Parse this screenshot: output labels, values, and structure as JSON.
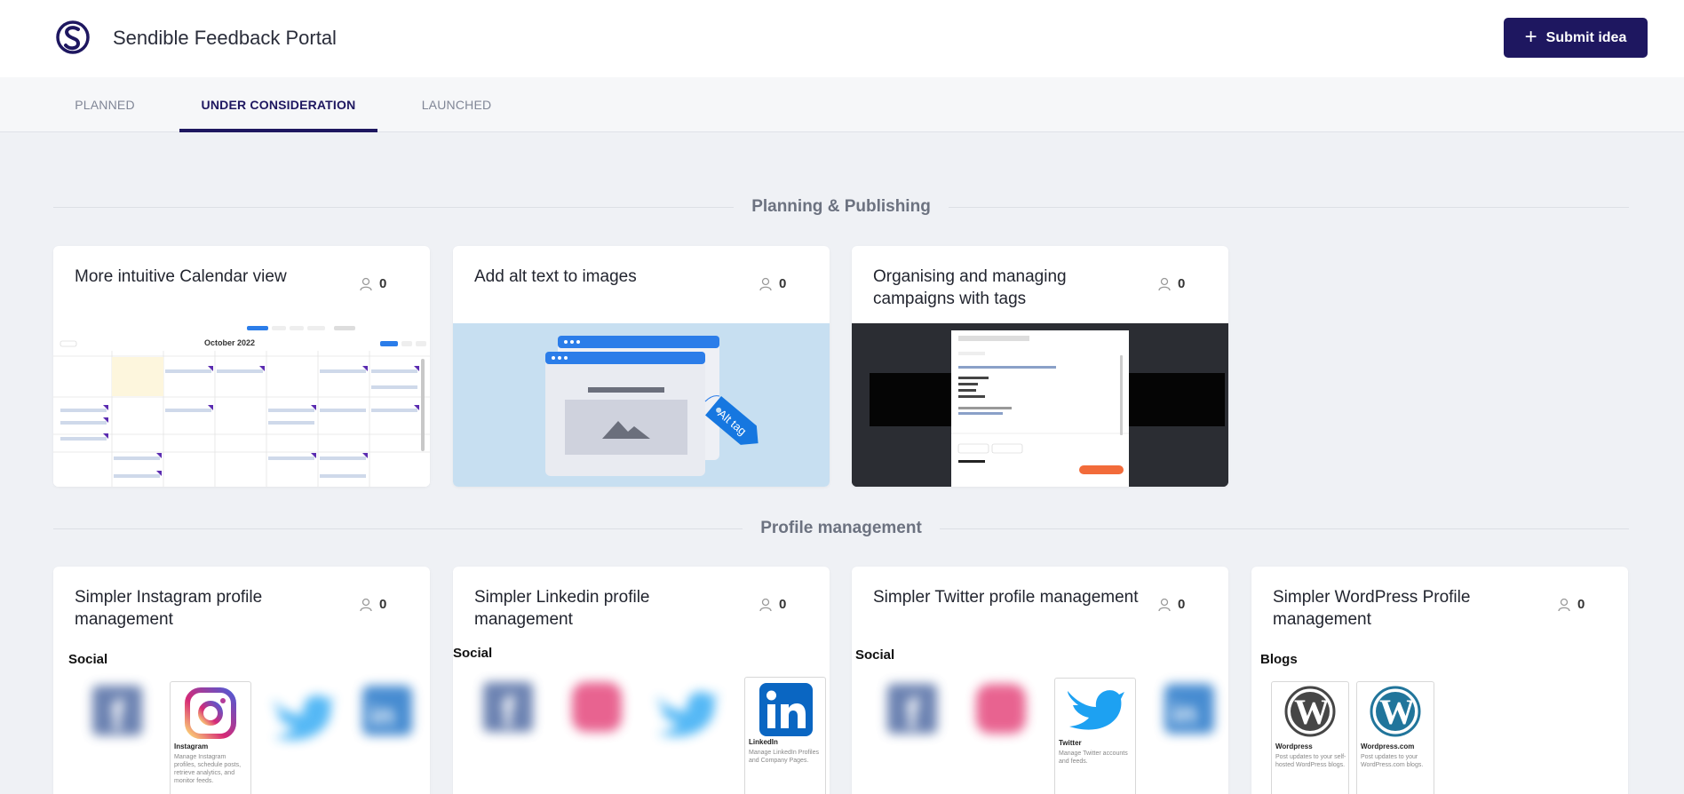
{
  "header": {
    "title": "Sendible Feedback Portal",
    "submit_label": "Submit idea"
  },
  "tabs": [
    {
      "label": "PLANNED",
      "active": false
    },
    {
      "label": "UNDER CONSIDERATION",
      "active": true
    },
    {
      "label": "LAUNCHED",
      "active": false
    }
  ],
  "sections": [
    {
      "title": "Planning & Publishing",
      "cards": [
        {
          "title": "More intuitive Calendar view",
          "votes": "0",
          "calendar_month": "October 2022"
        },
        {
          "title": "Add alt text to images",
          "votes": "0",
          "tag_text": "Alt tag"
        },
        {
          "title": "Organising and managing campaigns with tags",
          "votes": "0"
        }
      ]
    },
    {
      "title": "Profile management",
      "cards": [
        {
          "title": "Simpler Instagram profile management",
          "votes": "0",
          "category": "Social",
          "tile_name": "Instagram",
          "tile_desc": "Manage Instagram profiles, schedule posts, retrieve analytics, and monitor feeds."
        },
        {
          "title": "Simpler Linkedin profile management",
          "votes": "0",
          "category": "Social",
          "tile_name": "LinkedIn",
          "tile_desc": "Manage LinkedIn Profiles and Company Pages."
        },
        {
          "title": "Simpler Twitter profile management",
          "votes": "0",
          "category": "Social",
          "tile_name": "Twitter",
          "tile_desc": "Manage Twitter accounts and feeds."
        },
        {
          "title": "Simpler WordPress Profile management",
          "votes": "0",
          "category": "Blogs",
          "tiles": [
            {
              "name": "Wordpress",
              "desc": "Post updates to your self-hosted WordPress blogs."
            },
            {
              "name": "Wordpress.com",
              "desc": "Post updates to your WordPress.com blogs."
            }
          ]
        }
      ]
    }
  ],
  "colors": {
    "brand": "#1e1760",
    "background": "#eff1f5",
    "card": "#ffffff",
    "muted": "#808696"
  }
}
